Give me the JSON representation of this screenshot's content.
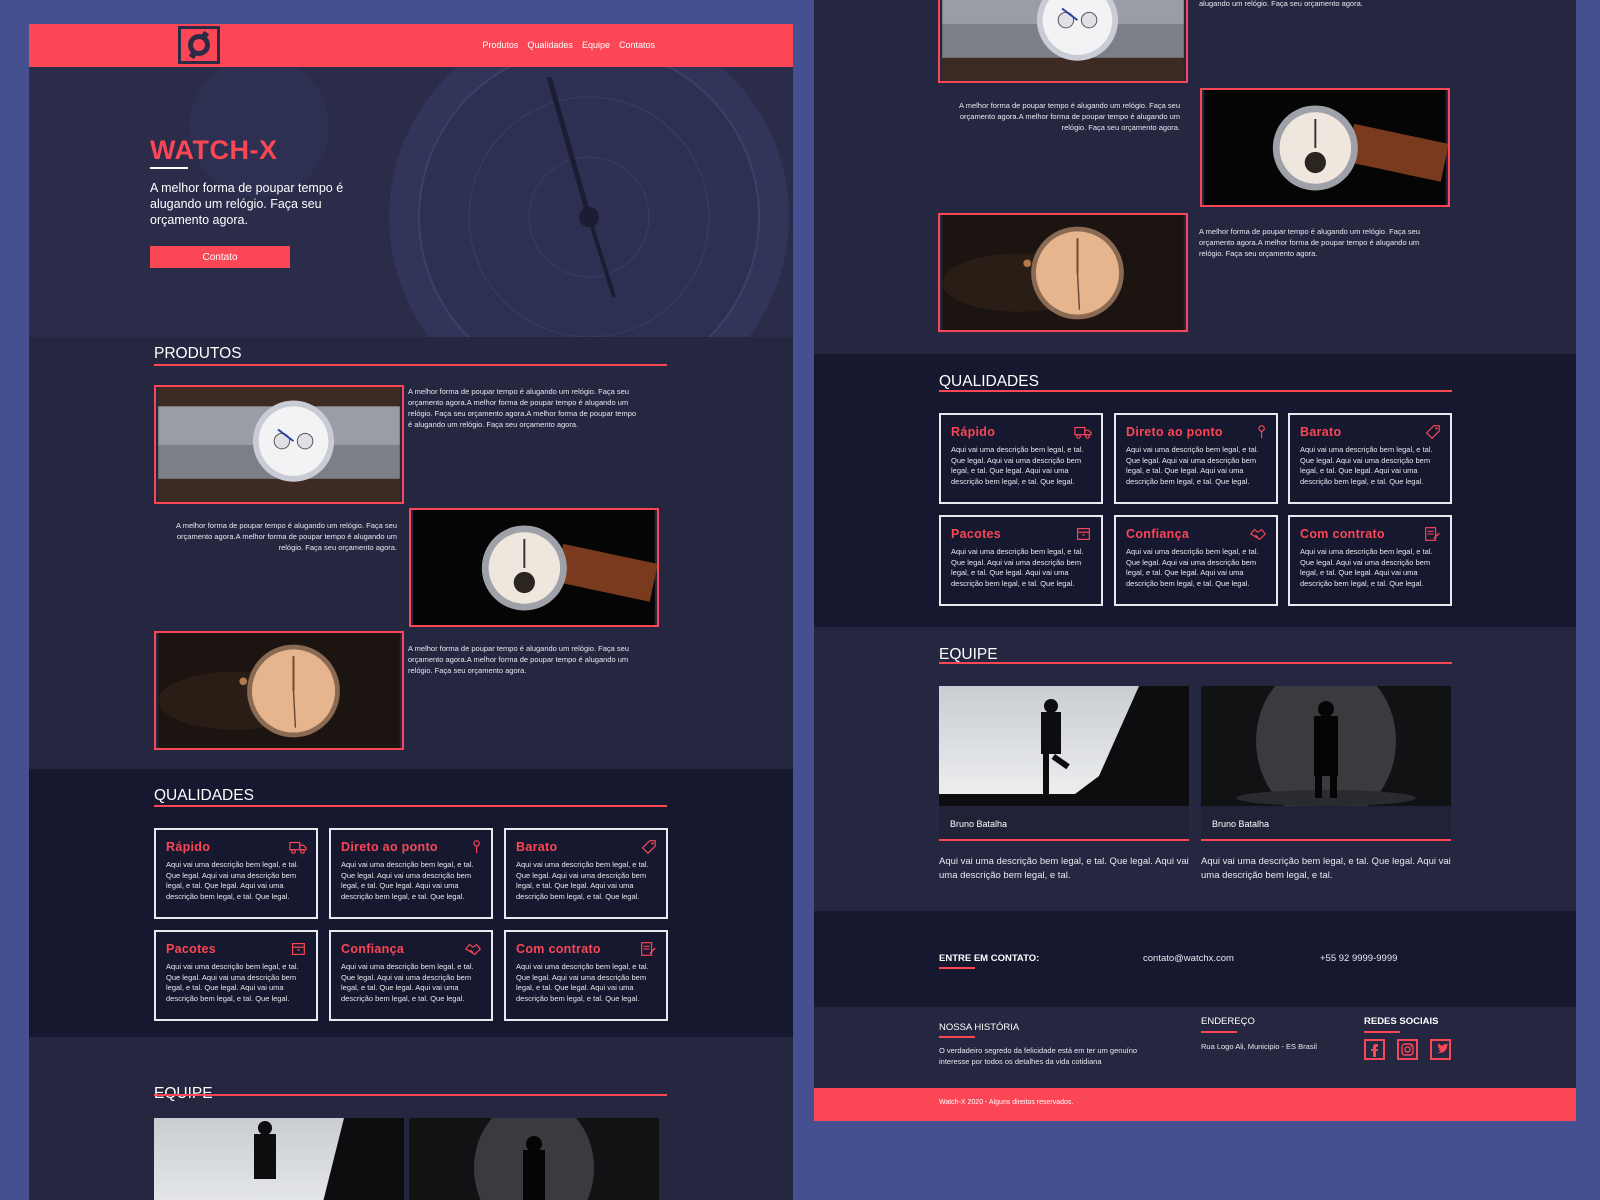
{
  "nav": {
    "links": [
      "Produtos",
      "Qualidades",
      "Equipe",
      "Contatos"
    ]
  },
  "hero": {
    "title": "WATCH-X",
    "text": "A melhor forma de poupar tempo é alugando um relógio. Faça seu orçamento agora.",
    "button": "Contato"
  },
  "produtos": {
    "title": "PRODUTOS",
    "items": [
      {
        "text": "A melhor forma de poupar tempo é alugando um relógio. Faça seu orçamento agora.A melhor forma de poupar tempo é alugando um relógio. Faça seu orçamento agora.A melhor forma de poupar tempo é alugando um relógio. Faça seu orçamento agora."
      },
      {
        "text": "A melhor forma de poupar tempo é alugando um relógio. Faça seu orçamento agora.A melhor forma de poupar tempo é alugando um relógio. Faça seu orçamento agora."
      },
      {
        "text": "A melhor forma de poupar tempo é alugando um relógio. Faça seu orçamento agora.A melhor forma de poupar tempo é alugando um relógio. Faça seu orçamento agora."
      }
    ],
    "partial_text": "alugando um relógio. Faça seu orçamento agora."
  },
  "qualidades": {
    "title": "QUALIDADES",
    "cards": [
      {
        "title": "Rápido",
        "icon": "truck-icon",
        "desc": "Aqui vai uma descrição bem legal, e tal. Que legal. Aqui vai uma descrição bem legal, e tal. Que legal. Aqui vai uma descrição bem legal, e tal. Que legal."
      },
      {
        "title": "Direto ao ponto",
        "icon": "pin-icon",
        "desc": "Aqui vai uma descrição bem legal, e tal. Que legal. Aqui vai uma descrição bem legal, e tal. Que legal. Aqui vai uma descrição bem legal, e tal. Que legal."
      },
      {
        "title": "Barato",
        "icon": "tag-icon",
        "desc": "Aqui vai uma descrição bem legal, e tal. Que legal. Aqui vai uma descrição bem legal, e tal. Que legal. Aqui vai uma descrição bem legal, e tal. Que legal."
      },
      {
        "title": "Pacotes",
        "icon": "package-icon",
        "desc": "Aqui vai uma descrição bem legal, e tal. Que legal. Aqui vai uma descrição bem legal, e tal. Que legal. Aqui vai uma descrição bem legal, e tal. Que legal."
      },
      {
        "title": "Confiança",
        "icon": "handshake-icon",
        "desc": "Aqui vai uma descrição bem legal, e tal. Que legal. Aqui vai uma descrição bem legal, e tal. Que legal. Aqui vai uma descrição bem legal, e tal. Que legal."
      },
      {
        "title": "Com contrato",
        "icon": "contract-icon",
        "desc": "Aqui vai uma descrição bem legal, e tal. Que legal. Aqui vai uma descrição bem legal, e tal. Que legal. Aqui vai uma descrição bem legal, e tal. Que legal."
      }
    ]
  },
  "equipe": {
    "title": "EQUIPE",
    "members": [
      {
        "name": "Bruno Batalha",
        "desc": "Aqui vai uma descrição bem legal, e tal. Que legal. Aqui vai uma descrição bem legal, e tal."
      },
      {
        "name": "Bruno Batalha",
        "desc": "Aqui vai uma descrição bem legal, e tal. Que legal. Aqui vai uma descrição bem legal, e tal."
      }
    ]
  },
  "contato": {
    "title": "ENTRE EM CONTATO:",
    "email": "contato@watchx.com",
    "phone": "+55 92 9999-9999"
  },
  "footer": {
    "historia_title": "NOSSA HISTÓRIA",
    "historia_text": "O verdadeiro segredo da felicidade está em ter um genuíno interesse por todos os detalhes da vida cotidiana",
    "endereco_title": "ENDEREÇO",
    "endereco_text": "Rua Logo Ali, Municipio - ES Brasil",
    "redes_title": "REDES SOCIAIS",
    "copyright": "Watch-X 2020 - Alguns direitos reservados."
  },
  "colors": {
    "accent": "#fb4655",
    "background": "#44508f",
    "panel": "#252741",
    "panel_dark": "#16182f"
  }
}
